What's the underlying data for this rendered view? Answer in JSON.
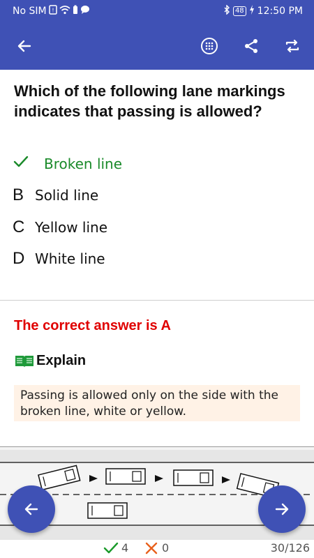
{
  "status_bar": {
    "carrier": "No SIM",
    "battery": "48",
    "time": "12:50 PM"
  },
  "toolbar": {
    "back_icon": "arrow-left-icon",
    "grid_icon": "grid-icon",
    "share_icon": "share-icon",
    "repeat_icon": "repeat-icon"
  },
  "question": {
    "text": "Which of the following lane markings indicates that passing is allowed?",
    "options": [
      {
        "letter": "A",
        "label": "Broken line",
        "state": "correct"
      },
      {
        "letter": "B",
        "label": "Solid line",
        "state": "normal"
      },
      {
        "letter": "C",
        "label": "Yellow line",
        "state": "normal"
      },
      {
        "letter": "D",
        "label": "White line",
        "state": "normal"
      }
    ]
  },
  "answer": {
    "text": "The correct answer is A"
  },
  "explain": {
    "heading": "Explain",
    "body": "Passing is allowed only on the side with the broken line, white or yellow."
  },
  "footer": {
    "correct_count": "4",
    "wrong_count": "0",
    "progress": "30/126"
  },
  "colors": {
    "primary": "#3f51b5",
    "correct": "#1a8a2a",
    "answer": "#e00000",
    "explain_bg": "#fff2e6"
  }
}
